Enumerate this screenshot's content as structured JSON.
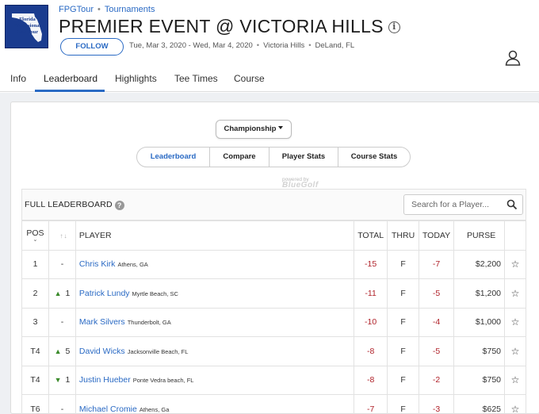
{
  "logo": {
    "text": "Florida Professional Golf Tour"
  },
  "breadcrumb": {
    "org": "FPGTour",
    "section": "Tournaments"
  },
  "event": {
    "title": "PREMIER EVENT @ VICTORIA HILLS",
    "follow_label": "FOLLOW",
    "dates": "Tue, Mar 3, 2020 - Wed, Mar 4, 2020",
    "venue": "Victoria Hills",
    "location": "DeLand, FL"
  },
  "nav": {
    "items": [
      "Info",
      "Leaderboard",
      "Highlights",
      "Tee Times",
      "Course"
    ],
    "active": "Leaderboard"
  },
  "division": {
    "label": "Championship"
  },
  "segments": {
    "items": [
      "Leaderboard",
      "Compare",
      "Player Stats",
      "Course Stats"
    ],
    "active": "Leaderboard"
  },
  "powered": {
    "text": "powered by",
    "brand": "BlueGolf"
  },
  "leaderboard": {
    "title": "FULL LEADERBOARD",
    "search_placeholder": "Search for a Player...",
    "columns": {
      "pos": "POS",
      "player": "PLAYER",
      "total": "TOTAL",
      "thru": "THRU",
      "today": "TODAY",
      "purse": "PURSE"
    },
    "rows": [
      {
        "pos": "1",
        "move_dir": "",
        "move": "-",
        "name": "Chris Kirk",
        "loc": "Athens, GA",
        "total": "-15",
        "thru": "F",
        "today": "-7",
        "purse": "$2,200"
      },
      {
        "pos": "2",
        "move_dir": "up",
        "move": "1",
        "name": "Patrick Lundy",
        "loc": "Myrtle Beach, SC",
        "total": "-11",
        "thru": "F",
        "today": "-5",
        "purse": "$1,200"
      },
      {
        "pos": "3",
        "move_dir": "",
        "move": "-",
        "name": "Mark Silvers",
        "loc": "Thunderbolt, GA",
        "total": "-10",
        "thru": "F",
        "today": "-4",
        "purse": "$1,000"
      },
      {
        "pos": "T4",
        "move_dir": "up",
        "move": "5",
        "name": "David Wicks",
        "loc": "Jacksonville Beach, FL",
        "total": "-8",
        "thru": "F",
        "today": "-5",
        "purse": "$750"
      },
      {
        "pos": "T4",
        "move_dir": "down",
        "move": "1",
        "name": "Justin Hueber",
        "loc": "Ponte Vedra beach, FL",
        "total": "-8",
        "thru": "F",
        "today": "-2",
        "purse": "$750"
      },
      {
        "pos": "T6",
        "move_dir": "",
        "move": "-",
        "name": "Michael Cromie",
        "loc": "Athens, Ga",
        "total": "-7",
        "thru": "F",
        "today": "-3",
        "purse": "$625"
      }
    ]
  },
  "colors": {
    "accent": "#2a6ac4",
    "negative": "#b0222a",
    "mover": "#3a8a2a",
    "logo_bg": "#1a3c8f"
  }
}
